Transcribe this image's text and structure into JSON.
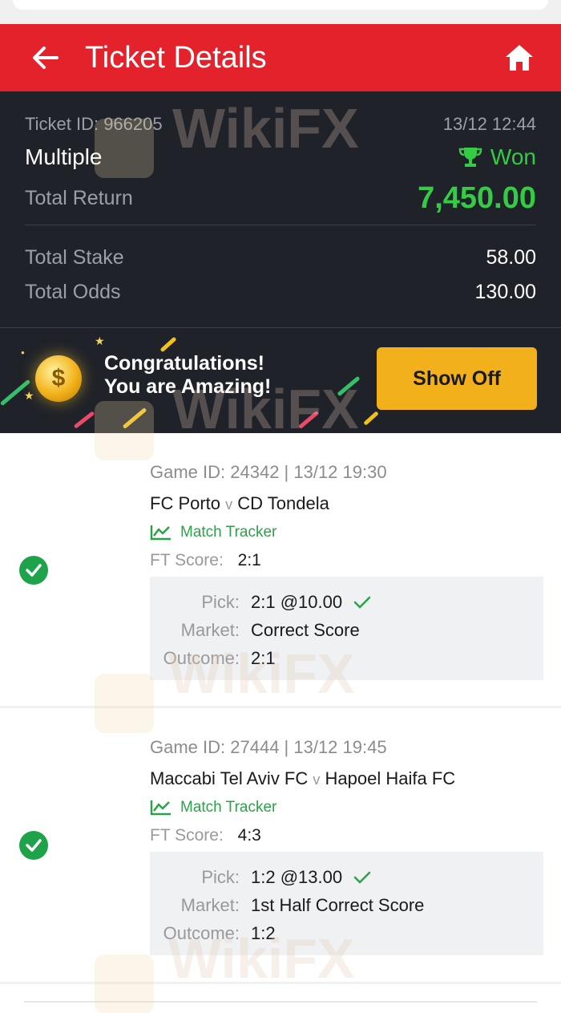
{
  "header": {
    "title": "Ticket Details",
    "back_icon": "arrow-left-icon",
    "home_icon": "home-icon"
  },
  "summary": {
    "ticket_id": "Ticket ID: 966205",
    "datetime": "13/12 12:44",
    "bet_type": "Multiple",
    "status": "Won",
    "total_return_label": "Total Return",
    "total_return_value": "7,450.00",
    "total_stake_label": "Total Stake",
    "total_stake_value": "58.00",
    "total_odds_label": "Total Odds",
    "total_odds_value": "130.00"
  },
  "promo": {
    "line1": "Congratulations!",
    "line2": "You are Amazing!",
    "button": "Show Off"
  },
  "games": [
    {
      "game_id": "Game ID: 24342 | 13/12 19:30",
      "home": "FC Porto",
      "vs": "v",
      "away": "CD Tondela",
      "tracker": "Match Tracker",
      "ft_label": "FT Score:",
      "ft_score": "2:1",
      "pick_label": "Pick:",
      "pick": "2:1 @10.00",
      "market_label": "Market:",
      "market": "Correct Score",
      "outcome_label": "Outcome:",
      "outcome": "2:1"
    },
    {
      "game_id": "Game ID: 27444 | 13/12 19:45",
      "home": "Maccabi Tel Aviv FC",
      "vs": "v",
      "away": "Hapoel Haifa FC",
      "tracker": "Match Tracker",
      "ft_label": "FT Score:",
      "ft_score": "4:3",
      "pick_label": "Pick:",
      "pick": "1:2 @13.00",
      "market_label": "Market:",
      "market": "1st Half Correct Score",
      "outcome_label": "Outcome:",
      "outcome": "1:2"
    }
  ],
  "watermark": "WikiFX",
  "colors": {
    "header_red": "#e4222c",
    "won_green": "#33cc44",
    "dark_bg": "#1f2229",
    "show_off_yellow": "#f2b01a"
  }
}
